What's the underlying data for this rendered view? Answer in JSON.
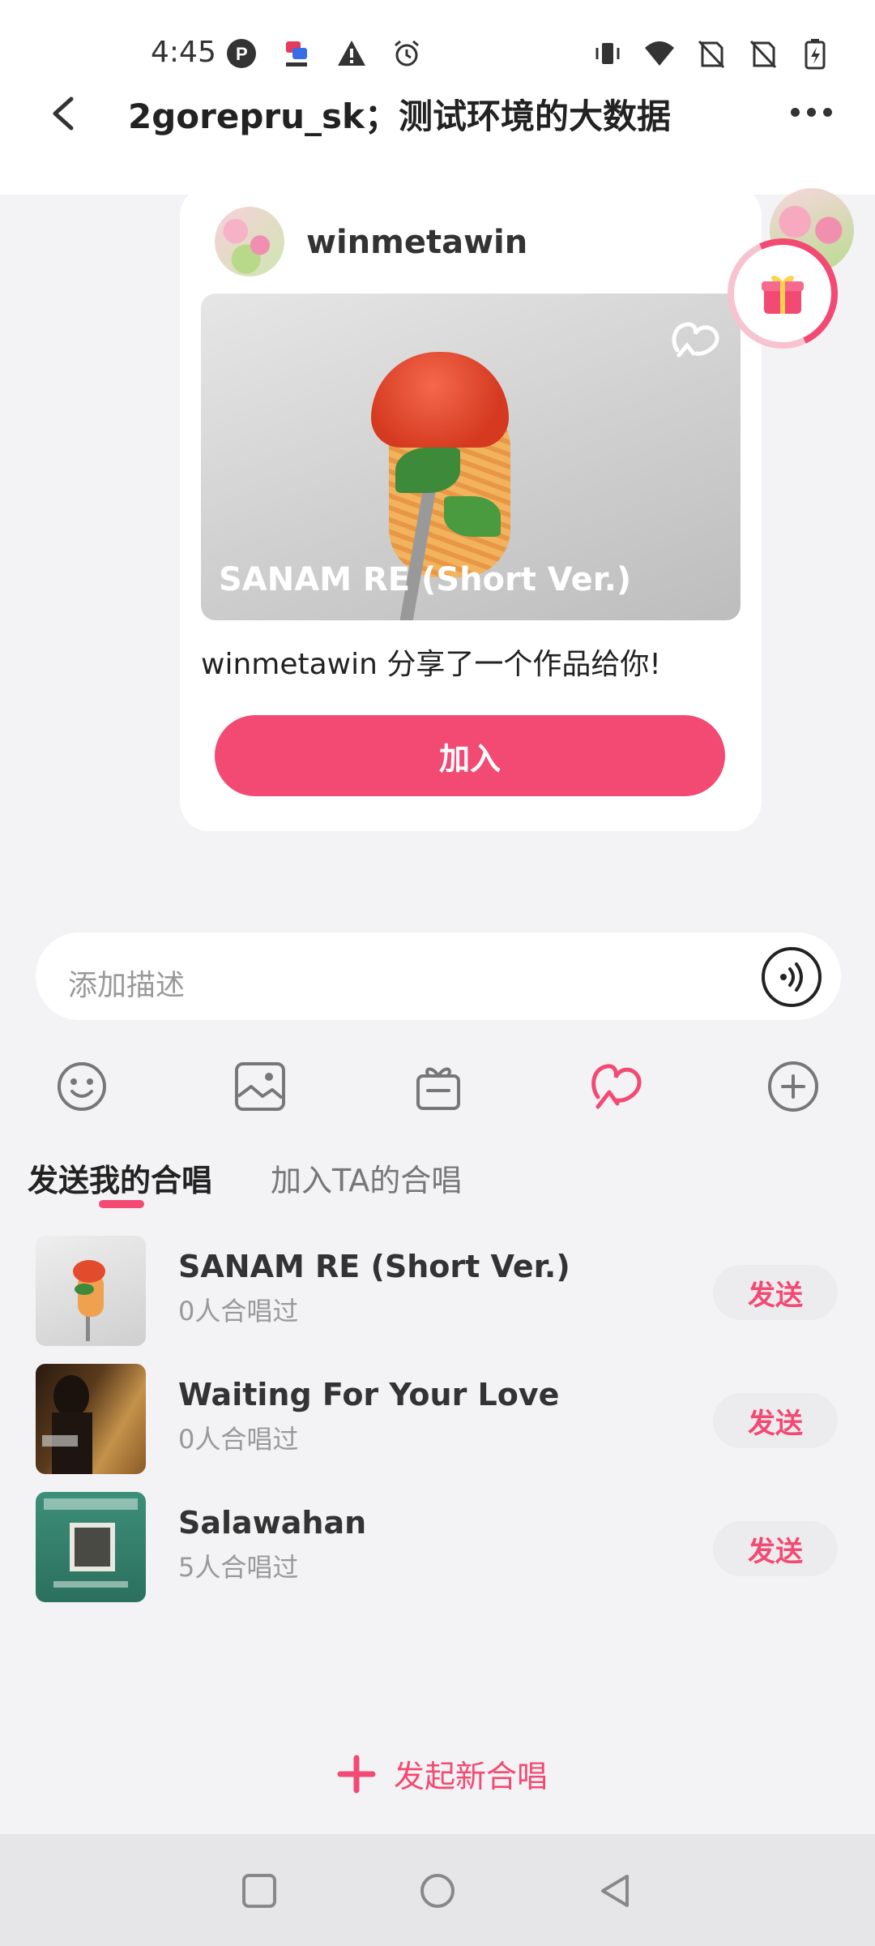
{
  "status_bar": {
    "time": "4:45",
    "left_icons": [
      "p-app-icon",
      "game-app-icon",
      "warning-icon",
      "alarm-icon"
    ],
    "right_icons": [
      "vibrate-icon",
      "wifi-icon",
      "no-sim-icon",
      "no-sim-icon",
      "battery-charging-icon"
    ]
  },
  "header": {
    "title": "2gorepru_sk；测试环境的大数据"
  },
  "card": {
    "username": "winmetawin",
    "song_title": "SANAM RE (Short Ver.)",
    "share_text": "winmetawin 分享了一个作品给你!",
    "join_label": "加入"
  },
  "input": {
    "placeholder": "添加描述"
  },
  "toolbar": {
    "icons": [
      "emoji-icon",
      "image-icon",
      "gift-icon",
      "duet-icon",
      "plus-icon"
    ],
    "accent": "#f24a72"
  },
  "tabs": {
    "active": "发送我的合唱",
    "inactive": "加入TA的合唱"
  },
  "songs": [
    {
      "title": "SANAM RE (Short Ver.)",
      "count": "0人合唱过",
      "send": "发送"
    },
    {
      "title": "Waiting For Your Love",
      "count": "0人合唱过",
      "send": "发送"
    },
    {
      "title": "Salawahan",
      "count": "5人合唱过",
      "send": "发送"
    }
  ],
  "new_duet_label": "发起新合唱",
  "colors": {
    "accent": "#f24a72",
    "background": "#f3f3f5"
  }
}
